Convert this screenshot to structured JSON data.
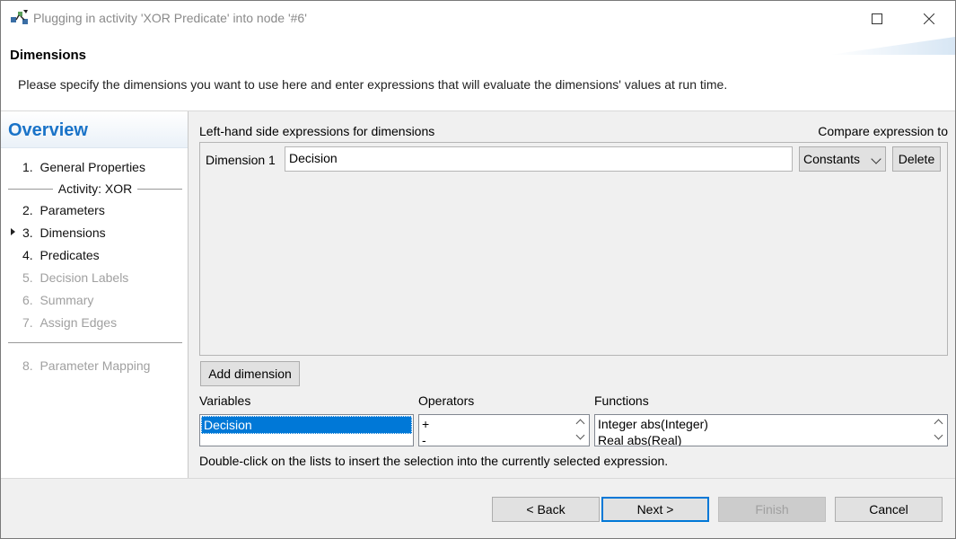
{
  "window": {
    "title": "Plugging in activity 'XOR Predicate' into node '#6'"
  },
  "header": {
    "title": "Dimensions",
    "description": "Please specify the dimensions you want to use here and enter expressions that will evaluate the dimensions' values at run time."
  },
  "nav": {
    "title": "Overview",
    "activity_label": "Activity: XOR",
    "current_index": 3,
    "items": [
      {
        "num": "1.",
        "label": "General Properties",
        "enabled": true
      },
      {
        "num": "2.",
        "label": "Parameters",
        "enabled": true
      },
      {
        "num": "3.",
        "label": "Dimensions",
        "enabled": true
      },
      {
        "num": "4.",
        "label": "Predicates",
        "enabled": true
      },
      {
        "num": "5.",
        "label": "Decision Labels",
        "enabled": false
      },
      {
        "num": "6.",
        "label": "Summary",
        "enabled": false
      },
      {
        "num": "7.",
        "label": "Assign Edges",
        "enabled": false
      },
      {
        "num": "8.",
        "label": "Parameter Mapping",
        "enabled": false
      }
    ]
  },
  "main": {
    "lhs_label": "Left-hand side expressions for dimensions",
    "compare_label": "Compare expression to",
    "dimensions": [
      {
        "label": "Dimension 1",
        "value": "Decision",
        "compare": "Constants",
        "delete_label": "Delete"
      }
    ],
    "add_dimension_label": "Add dimension",
    "variables": {
      "label": "Variables",
      "items": [
        "Decision"
      ],
      "selected": "Decision"
    },
    "operators": {
      "label": "Operators",
      "items": [
        "+",
        "-"
      ]
    },
    "functions": {
      "label": "Functions",
      "items": [
        "Integer abs(Integer)",
        "Real abs(Real)"
      ]
    },
    "hint": "Double-click on the lists to insert the selection into the currently selected expression."
  },
  "footer": {
    "back": "< Back",
    "next": "Next >",
    "finish": "Finish",
    "cancel": "Cancel"
  },
  "colors": {
    "accent": "#0078d7",
    "nav_title": "#1a73c8",
    "disabled_text": "#a0a0a0"
  }
}
